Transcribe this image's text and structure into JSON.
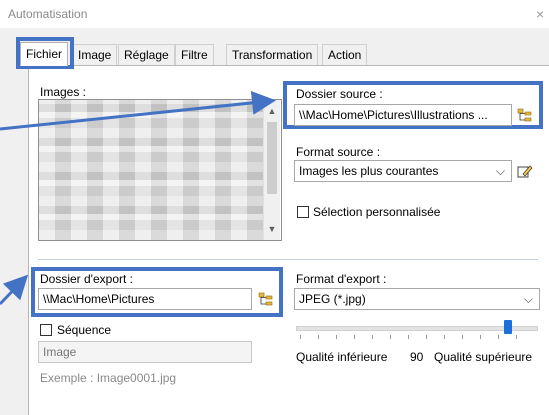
{
  "window": {
    "title": "Automatisation",
    "close": "×"
  },
  "tabs": [
    "Fichier",
    "Image",
    "Réglage",
    "Filtre",
    "Transformation",
    "Action"
  ],
  "left": {
    "images_label": "Images :",
    "export_folder_label": "Dossier d'export :",
    "export_folder_value": "\\\\Mac\\Home\\Pictures",
    "sequence_label": "Séquence",
    "sequence_checked": false,
    "sequence_value": "Image",
    "example": "Exemple : Image0001.jpg"
  },
  "right": {
    "source_folder_label": "Dossier source :",
    "source_folder_value": "\\\\Mac\\Home\\Pictures\\Illustrations ...",
    "source_format_label": "Format source :",
    "source_format_value": "Images les plus courantes",
    "custom_selection_label": "Sélection personnalisée",
    "custom_selection_checked": false,
    "export_format_label": "Format d'export :",
    "export_format_value": "JPEG (*.jpg)",
    "quality_low": "Qualité inférieure",
    "quality_value": "90",
    "quality_high": "Qualité supérieure"
  },
  "colors": {
    "highlight": "#4472c4",
    "slider": "#1e6fd9"
  },
  "icons": [
    "folder-tree-icon",
    "edit-pencil-icon",
    "chevron-down-icon",
    "scroll-up-arrow-icon",
    "scroll-down-arrow-icon"
  ]
}
